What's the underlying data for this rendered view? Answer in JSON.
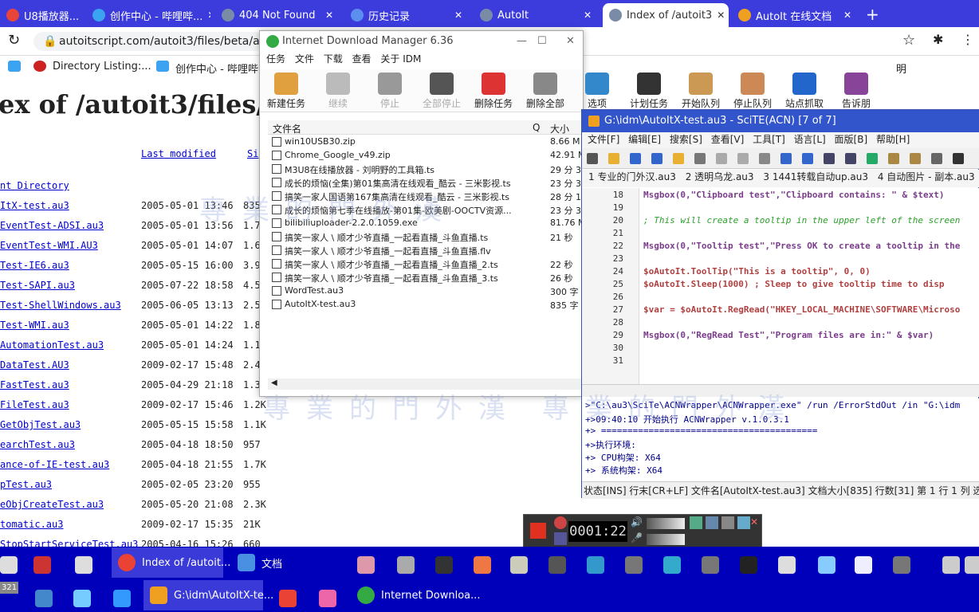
{
  "browser": {
    "tabs": [
      {
        "label": "U8播放器...",
        "fav_color": "#e8443a"
      },
      {
        "label": "创作中心 - 哔哩哔...",
        "fav_color": "#3ba3f0"
      },
      {
        "label": "404 Not Found",
        "fav_color": "#7a8ba8"
      },
      {
        "label": "历史记录",
        "fav_color": "#5c8ef0"
      },
      {
        "label": "AutoIt",
        "fav_color": "#7a8ba8"
      },
      {
        "label": "Index of /autoit3",
        "fav_color": "#7a8ba8"
      },
      {
        "label": "AutoIt 在线文档",
        "fav_color": "#f0a020"
      }
    ],
    "new_tab": "+",
    "address": "autoitscript.com/autoit3/files/beta/au",
    "bookmarks": [
      {
        "label": "Directory Listing:..."
      },
      {
        "label": "创作中心 - 哔哩哔..."
      },
      {
        "label": "明"
      }
    ]
  },
  "page": {
    "title": "ex of /autoit3/files/b",
    "header_last_modified": "Last modified",
    "header_size": "Si",
    "parent": "nt Directory",
    "rows": [
      {
        "name": "ItX-test.au3",
        "date": "2005-05-01 13:46",
        "size": "835"
      },
      {
        "name": "EventTest-ADSI.au3",
        "date": "2005-05-01 13:56",
        "size": "1.7"
      },
      {
        "name": "EventTest-WMI.AU3",
        "date": "2005-05-01 14:07",
        "size": "1.6"
      },
      {
        "name": "Test-IE6.au3",
        "date": "2005-05-15 16:00",
        "size": "3.9"
      },
      {
        "name": "Test-SAPI.au3",
        "date": "2005-07-22 18:58",
        "size": "4.5"
      },
      {
        "name": "Test-ShellWindows.au3",
        "date": "2005-06-05 13:13",
        "size": "2.5"
      },
      {
        "name": "Test-WMI.au3",
        "date": "2005-05-01 14:22",
        "size": "1.8"
      },
      {
        "name": "AutomationTest.au3",
        "date": "2005-05-01 14:24",
        "size": "1.1"
      },
      {
        "name": "DataTest.AU3",
        "date": "2009-02-17 15:48",
        "size": "2.4"
      },
      {
        "name": "FastTest.au3",
        "date": "2005-04-29 21:18",
        "size": "1.3"
      },
      {
        "name": "FileTest.au3",
        "date": "2009-02-17 15:46",
        "size": "1.2K"
      },
      {
        "name": "GetObjTest.au3",
        "date": "2005-05-15 15:58",
        "size": "1.1K"
      },
      {
        "name": "earchTest.au3",
        "date": "2005-04-18 18:50",
        "size": "957"
      },
      {
        "name": "ance-of-IE-test.au3",
        "date": "2005-04-18 21:55",
        "size": "1.7K"
      },
      {
        "name": "pTest.au3",
        "date": "2005-02-05 23:20",
        "size": "955"
      },
      {
        "name": "eObjCreateTest.au3",
        "date": "2005-05-20 21:08",
        "size": "2.3K"
      },
      {
        "name": "tomatic.au3",
        "date": "2009-02-17 15:35",
        "size": "21K"
      },
      {
        "name": "StopStartServiceTest.au3",
        "date": "2005-04-16 15:26",
        "size": "660"
      }
    ]
  },
  "idm": {
    "title": "Internet Download Manager 6.36",
    "menu": [
      "任务",
      "文件",
      "下载",
      "查看",
      "关于 IDM"
    ],
    "toolbar": [
      {
        "label": "新建任务",
        "color": "#e0a040",
        "disabled": false
      },
      {
        "label": "继续",
        "color": "#bbbbbb",
        "disabled": true
      },
      {
        "label": "停止",
        "color": "#999999",
        "disabled": true
      },
      {
        "label": "全部停止",
        "color": "#555555",
        "disabled": true
      },
      {
        "label": "删除任务",
        "color": "#dd3333",
        "disabled": false
      },
      {
        "label": "删除全部",
        "color": "#888888",
        "disabled": false
      },
      {
        "label": "选项",
        "color": "#3388cc",
        "disabled": false
      },
      {
        "label": "计划任务",
        "color": "#333333",
        "disabled": false
      },
      {
        "label": "开始队列",
        "color": "#cc9955",
        "disabled": false
      },
      {
        "label": "停止队列",
        "color": "#cc8855",
        "disabled": false
      },
      {
        "label": "站点抓取",
        "color": "#2266cc",
        "disabled": false
      },
      {
        "label": "告诉朋",
        "color": "#884499",
        "disabled": false
      }
    ],
    "col_name": "文件名",
    "col_q": "Q",
    "col_size": "大小",
    "files": [
      {
        "name": "win10USB30.zip",
        "size": "8.66 M"
      },
      {
        "name": "Chrome_Google_v49.zip",
        "size": "42.91 M"
      },
      {
        "name": "M3U8在线播放器 - 刘明野的工具箱.ts",
        "size": "29 分 3"
      },
      {
        "name": "成长的烦恼(全集)第01集高清在线观看_酷云 - 三米影视.ts",
        "size": "23 分 3"
      },
      {
        "name": "搞笑一家人国语第167集高清在线观看_酷云 - 三米影视.ts",
        "size": "28 分 1"
      },
      {
        "name": "成长的烦恼第七季在线播放-第01集-欧美剧-OOCTV资源...",
        "size": "23 分 3"
      },
      {
        "name": "bilibiliuploader-2.2.0.1059.exe",
        "size": "81.76 M"
      },
      {
        "name": "搞笑一家人 \\ 顺才少爷直播_一起看直播_斗鱼直播.ts",
        "size": "21 秒"
      },
      {
        "name": "搞笑一家人 \\ 顺才少爷直播_一起看直播_斗鱼直播.flv",
        "size": ""
      },
      {
        "name": "搞笑一家人 \\ 顺才少爷直播_一起看直播_斗鱼直播_2.ts",
        "size": "22 秒"
      },
      {
        "name": "搞笑一家人 \\ 顺才少爷直播_一起看直播_斗鱼直播_3.ts",
        "size": "26 秒"
      },
      {
        "name": "WordTest.au3",
        "size": "300 字"
      },
      {
        "name": "AutoItX-test.au3",
        "size": "835 字"
      }
    ]
  },
  "scite": {
    "title": "G:\\idm\\AutoItX-test.au3 - SciTE(ACN) [7 of 7]",
    "menu": [
      "文件[F]",
      "编辑[E]",
      "搜索[S]",
      "查看[V]",
      "工具[T]",
      "语言[L]",
      "面版[B]",
      "帮助[H]"
    ],
    "tabs": [
      "1 专业的门外汉.au3",
      "2 透明乌龙.au3",
      "3 1441转载自动up.au3",
      "4 自动图片 - 副本.au3"
    ],
    "lines": [
      {
        "n": "18",
        "code": "Msgbox(0,\"Clipboard test\",\"Clipboard contains: \" & $text)",
        "color": "#7a3d8a"
      },
      {
        "n": "19",
        "code": "",
        "color": "#333"
      },
      {
        "n": "20",
        "code": "; This will create a tooltip in the upper left of the screen",
        "color": "#2aa02a"
      },
      {
        "n": "21",
        "code": "",
        "color": "#333"
      },
      {
        "n": "22",
        "code": "Msgbox(0,\"Tooltip test\",\"Press OK to create a tooltip in the",
        "color": "#7a3d8a"
      },
      {
        "n": "23",
        "code": "",
        "color": "#333"
      },
      {
        "n": "24",
        "code": "$oAutoIt.ToolTip(\"This is a tooltip\", 0, 0)",
        "color": "#b04040"
      },
      {
        "n": "25",
        "code": "$oAutoIt.Sleep(1000)      ; Sleep to give tooltip time to disp",
        "color": "#b04040"
      },
      {
        "n": "26",
        "code": "",
        "color": "#333"
      },
      {
        "n": "27",
        "code": "$var = $oAutoIt.RegRead(\"HKEY_LOCAL_MACHINE\\SOFTWARE\\Microso",
        "color": "#b04040"
      },
      {
        "n": "28",
        "code": "",
        "color": "#333"
      },
      {
        "n": "29",
        "code": "Msgbox(0,\"RegRead Test\",\"Program files are in:\" & $var)",
        "color": "#7a3d8a"
      },
      {
        "n": "30",
        "code": "",
        "color": "#333"
      },
      {
        "n": "31",
        "code": "",
        "color": "#333"
      }
    ],
    "output": [
      ">\"C:\\au3\\SciTe\\ACNWrapper\\ACNWrapper.exe\" /run /ErrorStdOut /in \"G:\\idm",
      "+>09:40:10 开始执行 ACNWrapper v.1.0.3.1",
      "+> =========================================",
      "+>执行环境:",
      "+>       CPU构架:         X64",
      "+>       系统构架:        X64"
    ],
    "status": "状态[INS] 行末[CR+LF] 文件名[AutoItX-test.au3] 文档大小[835] 行数[31] 第 1 行 1 列 选中"
  },
  "recorder": {
    "time": "0001:22"
  },
  "taskbar": {
    "row1": [
      {
        "label": "Index of /autoit...",
        "color": "#ea4335"
      },
      {
        "label": "文档",
        "color": "#4a90e2"
      }
    ],
    "row2": [
      {
        "label": "G:\\idm\\AutoItX-te...",
        "color": "#f0a020"
      },
      {
        "label": "Internet Downloa...",
        "color": "#33aa44"
      }
    ],
    "tray_time": "321"
  },
  "watermark": "專業的門外漢"
}
